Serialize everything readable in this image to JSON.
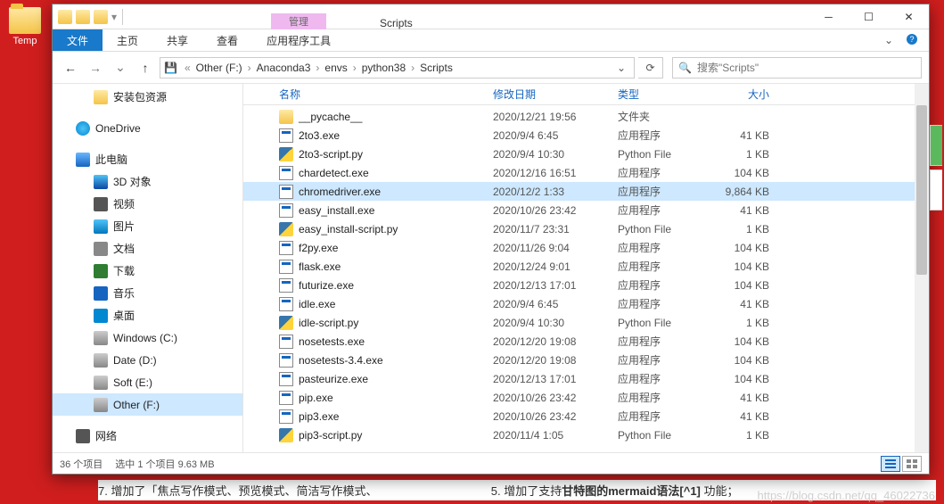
{
  "desktop": {
    "icon_label": "Temp"
  },
  "window": {
    "ctx_tab_label": "管理",
    "title": "Scripts",
    "ribbon": {
      "file": "文件",
      "home": "主页",
      "share": "共享",
      "view": "查看",
      "tools": "应用程序工具"
    },
    "nav": {
      "crumbs": [
        "Other (F:)",
        "Anaconda3",
        "envs",
        "python38",
        "Scripts"
      ],
      "search_placeholder": "搜索\"Scripts\""
    },
    "sidebar": {
      "items": [
        {
          "label": "安装包资源",
          "ico": "ico-folder-y",
          "level": 2
        },
        {
          "spacer": true
        },
        {
          "label": "OneDrive",
          "ico": "ico-onedrive",
          "level": 1
        },
        {
          "spacer": true
        },
        {
          "label": "此电脑",
          "ico": "ico-pc",
          "level": 1
        },
        {
          "label": "3D 对象",
          "ico": "ico-3d",
          "level": 2
        },
        {
          "label": "视频",
          "ico": "ico-video",
          "level": 2
        },
        {
          "label": "图片",
          "ico": "ico-img",
          "level": 2
        },
        {
          "label": "文档",
          "ico": "ico-doc",
          "level": 2
        },
        {
          "label": "下载",
          "ico": "ico-dl",
          "level": 2
        },
        {
          "label": "音乐",
          "ico": "ico-music",
          "level": 2
        },
        {
          "label": "桌面",
          "ico": "ico-desktop",
          "level": 2
        },
        {
          "label": "Windows (C:)",
          "ico": "ico-drive",
          "level": 2
        },
        {
          "label": "Date (D:)",
          "ico": "ico-drive",
          "level": 2
        },
        {
          "label": "Soft (E:)",
          "ico": "ico-drive",
          "level": 2
        },
        {
          "label": "Other (F:)",
          "ico": "ico-drive",
          "level": 2,
          "selected": true
        },
        {
          "spacer": true
        },
        {
          "label": "网络",
          "ico": "ico-net",
          "level": 1
        }
      ]
    },
    "columns": {
      "name": "名称",
      "date": "修改日期",
      "type": "类型",
      "size": "大小"
    },
    "files": [
      {
        "name": "__pycache__",
        "date": "2020/12/21 19:56",
        "type": "文件夹",
        "size": "",
        "ico": "ico-folder-sm"
      },
      {
        "name": "2to3.exe",
        "date": "2020/9/4 6:45",
        "type": "应用程序",
        "size": "41 KB",
        "ico": "ico-exe"
      },
      {
        "name": "2to3-script.py",
        "date": "2020/9/4 10:30",
        "type": "Python File",
        "size": "1 KB",
        "ico": "ico-pyfile"
      },
      {
        "name": "chardetect.exe",
        "date": "2020/12/16 16:51",
        "type": "应用程序",
        "size": "104 KB",
        "ico": "ico-exe"
      },
      {
        "name": "chromedriver.exe",
        "date": "2020/12/2 1:33",
        "type": "应用程序",
        "size": "9,864 KB",
        "ico": "ico-exe",
        "selected": true
      },
      {
        "name": "easy_install.exe",
        "date": "2020/10/26 23:42",
        "type": "应用程序",
        "size": "41 KB",
        "ico": "ico-exe"
      },
      {
        "name": "easy_install-script.py",
        "date": "2020/11/7 23:31",
        "type": "Python File",
        "size": "1 KB",
        "ico": "ico-pyfile"
      },
      {
        "name": "f2py.exe",
        "date": "2020/11/26 9:04",
        "type": "应用程序",
        "size": "104 KB",
        "ico": "ico-exe"
      },
      {
        "name": "flask.exe",
        "date": "2020/12/24 9:01",
        "type": "应用程序",
        "size": "104 KB",
        "ico": "ico-exe"
      },
      {
        "name": "futurize.exe",
        "date": "2020/12/13 17:01",
        "type": "应用程序",
        "size": "104 KB",
        "ico": "ico-exe"
      },
      {
        "name": "idle.exe",
        "date": "2020/9/4 6:45",
        "type": "应用程序",
        "size": "41 KB",
        "ico": "ico-exe"
      },
      {
        "name": "idle-script.py",
        "date": "2020/9/4 10:30",
        "type": "Python File",
        "size": "1 KB",
        "ico": "ico-pyfile"
      },
      {
        "name": "nosetests.exe",
        "date": "2020/12/20 19:08",
        "type": "应用程序",
        "size": "104 KB",
        "ico": "ico-exe"
      },
      {
        "name": "nosetests-3.4.exe",
        "date": "2020/12/20 19:08",
        "type": "应用程序",
        "size": "104 KB",
        "ico": "ico-exe"
      },
      {
        "name": "pasteurize.exe",
        "date": "2020/12/13 17:01",
        "type": "应用程序",
        "size": "104 KB",
        "ico": "ico-exe"
      },
      {
        "name": "pip.exe",
        "date": "2020/10/26 23:42",
        "type": "应用程序",
        "size": "41 KB",
        "ico": "ico-exe"
      },
      {
        "name": "pip3.exe",
        "date": "2020/10/26 23:42",
        "type": "应用程序",
        "size": "41 KB",
        "ico": "ico-exe"
      },
      {
        "name": "pip3-script.py",
        "date": "2020/11/4 1:05",
        "type": "Python File",
        "size": "1 KB",
        "ico": "ico-pyfile"
      }
    ],
    "status": {
      "count": "36 个项目",
      "selection": "选中 1 个项目 9.63 MB"
    }
  },
  "background_text": {
    "left_num": "7.",
    "left": "增加了「焦点写作模式、预览模式、简洁写作模式、",
    "right_num": "5.",
    "right_a": "增加了支持",
    "right_b": "甘特图的mermaid语法[^1]",
    "right_c": " 功能；"
  },
  "watermark": "https://blog.csdn.net/qq_46022736"
}
